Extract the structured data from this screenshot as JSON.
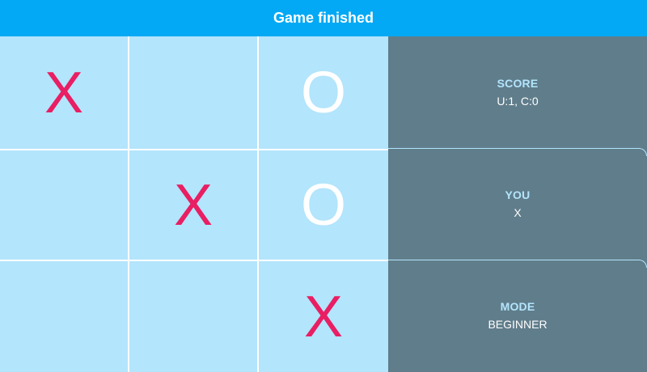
{
  "header": {
    "status": "Game finished"
  },
  "board": {
    "cells": [
      "X",
      "",
      "O",
      "",
      "X",
      "O",
      "",
      "",
      "X"
    ]
  },
  "info": {
    "score": {
      "label": "SCORE",
      "value": "U:1, C:0"
    },
    "you": {
      "label": "YOU",
      "value": "X"
    },
    "mode": {
      "label": "MODE",
      "value": "BEGINNER"
    }
  },
  "colors": {
    "header_bg": "#03a9f4",
    "board_bg": "#b3e5fc",
    "panel_bg": "#607d8b",
    "x_mark": "#e91e63",
    "o_mark": "#ffffff",
    "label": "#b3e5fc"
  }
}
